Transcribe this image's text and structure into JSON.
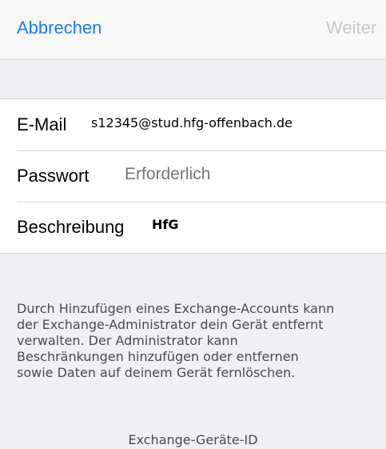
{
  "navbar": {
    "cancel_label": "Abbrechen",
    "next_label": "Weiter"
  },
  "form": {
    "email": {
      "label": "E-Mail",
      "value": "s12345@stud.hfg-offenbach.de"
    },
    "password": {
      "label": "Passwort",
      "placeholder": "Erforderlich",
      "value": ""
    },
    "description": {
      "label": "Beschreibung",
      "value": "HfG"
    }
  },
  "info": {
    "lines": [
      "Durch Hinzufügen eines Exchange-Accounts kann",
      "der Exchange-Administrator dein Gerät entfernt",
      "verwalten. Der Administrator kann",
      "Beschränkungen hinzufügen oder entfernen",
      "sowie Daten auf deinem Gerät fernlöschen."
    ],
    "device_id_label": "Exchange-Geräte-ID"
  },
  "colors": {
    "accent": "#1a7cf5",
    "disabled": "#c7c7cc",
    "background": "#efeff4",
    "cell": "#ffffff",
    "separator": "#d6d6da"
  }
}
